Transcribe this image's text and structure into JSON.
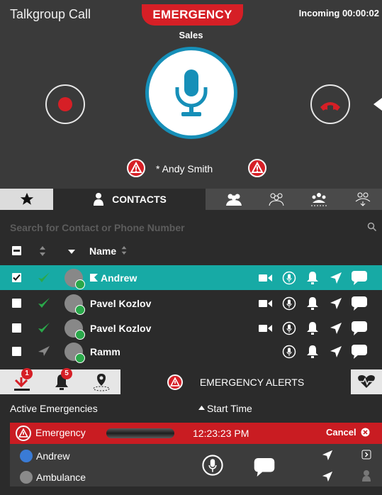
{
  "call": {
    "title": "Talkgroup Call",
    "emergency_banner": "EMERGENCY",
    "incoming_status": "Incoming 00:00:02",
    "group_name": "Sales",
    "speaker": "* Andy Smith"
  },
  "tabs": {
    "contacts_label": "CONTACTS"
  },
  "contacts": {
    "search_placeholder": "Search for Contact or Phone Number",
    "column_name": "Name",
    "rows": [
      {
        "name": "Andrew",
        "selected": true
      },
      {
        "name": "Pavel Kozlov",
        "selected": false
      },
      {
        "name": "Pavel Kozlov",
        "selected": false
      },
      {
        "name": "Ramm",
        "selected": false
      }
    ]
  },
  "alerts": {
    "tab_label": "EMERGENCY ALERTS",
    "badge_1": "1",
    "badge_2": "5",
    "active_label": "Active Emergencies",
    "start_time_label": "Start Time",
    "emergency": {
      "label": "Emergency",
      "time": "12:23:23 PM",
      "cancel_label": "Cancel"
    },
    "members": [
      "Andrew",
      "Ambulance"
    ]
  },
  "colors": {
    "emergency_red": "#d61f26",
    "ptt_blue": "#168fb8",
    "selected_teal": "#17aaa5",
    "status_green": "#2aa84a"
  }
}
